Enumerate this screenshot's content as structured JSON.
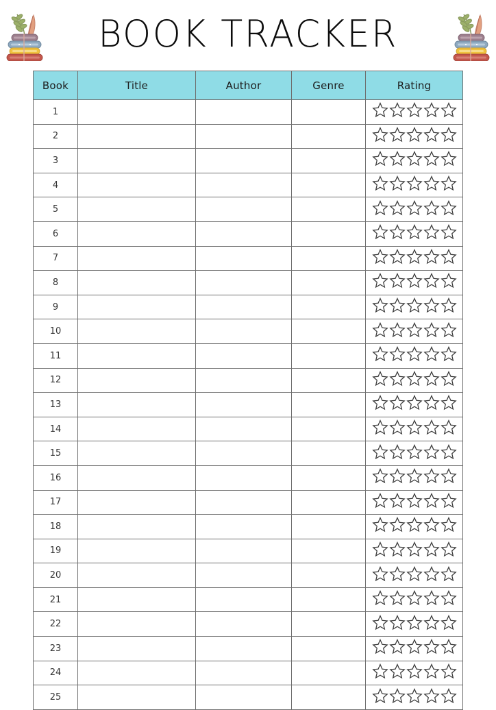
{
  "page": {
    "title": "BOOK TRACKER",
    "background_color": "#ffffff",
    "accent_color": "#8fdce6",
    "border_color": "#6f6f6f",
    "text_color": "#1d1d1d"
  },
  "decorations": {
    "left_illustration": "book-stack-illustration",
    "right_illustration": "book-stack-illustration",
    "illustration_description": "stack of four books with leafy sprig and feather",
    "book_colors": [
      "#9d7f8d",
      "#8ea9c0",
      "#f0c23f",
      "#c4574c"
    ]
  },
  "table": {
    "columns": [
      {
        "key": "book",
        "label": "Book"
      },
      {
        "key": "title",
        "label": "Title"
      },
      {
        "key": "author",
        "label": "Author"
      },
      {
        "key": "genre",
        "label": "Genre"
      },
      {
        "key": "rating",
        "label": "Rating"
      }
    ],
    "rating_stars_per_row": 5,
    "rating_stars_filled": 0,
    "rows": [
      {
        "book": "1",
        "title": "",
        "author": "",
        "genre": "",
        "rating": 0
      },
      {
        "book": "2",
        "title": "",
        "author": "",
        "genre": "",
        "rating": 0
      },
      {
        "book": "3",
        "title": "",
        "author": "",
        "genre": "",
        "rating": 0
      },
      {
        "book": "4",
        "title": "",
        "author": "",
        "genre": "",
        "rating": 0
      },
      {
        "book": "5",
        "title": "",
        "author": "",
        "genre": "",
        "rating": 0
      },
      {
        "book": "6",
        "title": "",
        "author": "",
        "genre": "",
        "rating": 0
      },
      {
        "book": "7",
        "title": "",
        "author": "",
        "genre": "",
        "rating": 0
      },
      {
        "book": "8",
        "title": "",
        "author": "",
        "genre": "",
        "rating": 0
      },
      {
        "book": "9",
        "title": "",
        "author": "",
        "genre": "",
        "rating": 0
      },
      {
        "book": "10",
        "title": "",
        "author": "",
        "genre": "",
        "rating": 0
      },
      {
        "book": "11",
        "title": "",
        "author": "",
        "genre": "",
        "rating": 0
      },
      {
        "book": "12",
        "title": "",
        "author": "",
        "genre": "",
        "rating": 0
      },
      {
        "book": "13",
        "title": "",
        "author": "",
        "genre": "",
        "rating": 0
      },
      {
        "book": "14",
        "title": "",
        "author": "",
        "genre": "",
        "rating": 0
      },
      {
        "book": "15",
        "title": "",
        "author": "",
        "genre": "",
        "rating": 0
      },
      {
        "book": "16",
        "title": "",
        "author": "",
        "genre": "",
        "rating": 0
      },
      {
        "book": "17",
        "title": "",
        "author": "",
        "genre": "",
        "rating": 0
      },
      {
        "book": "18",
        "title": "",
        "author": "",
        "genre": "",
        "rating": 0
      },
      {
        "book": "19",
        "title": "",
        "author": "",
        "genre": "",
        "rating": 0
      },
      {
        "book": "20",
        "title": "",
        "author": "",
        "genre": "",
        "rating": 0
      },
      {
        "book": "21",
        "title": "",
        "author": "",
        "genre": "",
        "rating": 0
      },
      {
        "book": "22",
        "title": "",
        "author": "",
        "genre": "",
        "rating": 0
      },
      {
        "book": "23",
        "title": "",
        "author": "",
        "genre": "",
        "rating": 0
      },
      {
        "book": "24",
        "title": "",
        "author": "",
        "genre": "",
        "rating": 0
      },
      {
        "book": "25",
        "title": "",
        "author": "",
        "genre": "",
        "rating": 0
      }
    ]
  }
}
